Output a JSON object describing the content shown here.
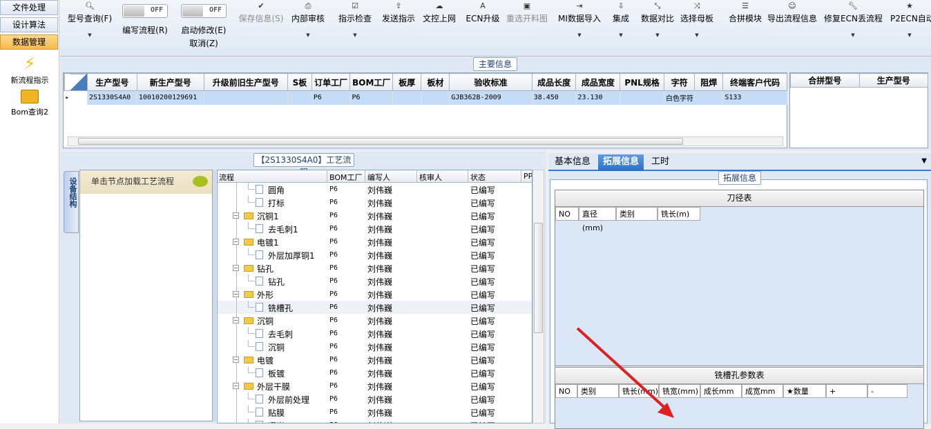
{
  "leftnav": {
    "items": [
      {
        "label": "文件处理"
      },
      {
        "label": "设计算法"
      },
      {
        "label": "数据管理"
      }
    ],
    "icons": [
      {
        "label": "新流程指示",
        "color": "#f1c40f"
      },
      {
        "label": "Bom查询2",
        "color": "#f0b323"
      }
    ]
  },
  "toolbar": {
    "buttons": [
      {
        "label": "型号查询(F)",
        "icon": "search-icon",
        "glyph": "🔍︎",
        "disabled": false,
        "dropdown": true
      },
      {
        "label": "保存信息(S)",
        "icon": "check-icon",
        "glyph": "✔",
        "disabled": true,
        "dropdown": false
      },
      {
        "label": "内部审核",
        "icon": "printer-icon",
        "glyph": "⎙",
        "disabled": false,
        "dropdown": true
      },
      {
        "label": "指示检查",
        "icon": "checkbox-icon",
        "glyph": "☑",
        "disabled": false,
        "dropdown": true
      },
      {
        "label": "发送指示",
        "icon": "upload-icon",
        "glyph": "⇪",
        "disabled": false,
        "dropdown": false
      },
      {
        "label": "文控上网",
        "icon": "cloud-upload-icon",
        "glyph": "☁",
        "disabled": false,
        "dropdown": false
      },
      {
        "label": "ECN升级",
        "icon": "font-icon",
        "glyph": "A",
        "disabled": false,
        "dropdown": false
      },
      {
        "label": "重选开料图",
        "icon": "picture-icon",
        "glyph": "▣",
        "disabled": true,
        "dropdown": false
      },
      {
        "label": "MI数据导入",
        "icon": "import-icon",
        "glyph": "⇥",
        "disabled": false,
        "dropdown": true
      },
      {
        "label": "集成",
        "icon": "download-icon",
        "glyph": "⇩",
        "disabled": false,
        "dropdown": true
      },
      {
        "label": "数据对比",
        "icon": "compress-icon",
        "glyph": "⤡",
        "disabled": false,
        "dropdown": true
      },
      {
        "label": "选择母板",
        "icon": "shuffle-icon",
        "glyph": "⤨",
        "disabled": false,
        "dropdown": true
      },
      {
        "label": "合拼模块",
        "icon": "list-icon",
        "glyph": "☰",
        "disabled": false,
        "dropdown": false
      },
      {
        "label": "导出流程信息",
        "icon": "smile-icon",
        "glyph": "☺",
        "disabled": false,
        "dropdown": false
      },
      {
        "label": "修复ECN丢流程",
        "icon": "wrench-icon",
        "glyph": "🔧︎",
        "disabled": false,
        "dropdown": true
      },
      {
        "label": "P2ECN自动",
        "icon": "star-icon",
        "glyph": "★",
        "disabled": false,
        "dropdown": true
      }
    ],
    "toggle_write": {
      "label": "编写流程(R)",
      "state": "OFF"
    },
    "toggle_modify": {
      "label1": "启动修改(E)",
      "label2": "取消(Z)",
      "state": "OFF"
    }
  },
  "main": {
    "title": "主要信息",
    "columns": [
      "生产型号",
      "新生产型号",
      "升级前旧生产型号",
      "S板",
      "订单工厂",
      "BOM工厂",
      "板厚",
      "板材",
      "验收标准",
      "成品长度",
      "成品宽度",
      "PNL规格",
      "字符",
      "阻焊",
      "终端客户代码"
    ],
    "rows": [
      [
        "2S1330S4A0",
        "10010200129691",
        "",
        "",
        "P6",
        "P6",
        "",
        "",
        "GJB362B-2009",
        "38.450",
        "23.130",
        "",
        "白色字符",
        "",
        "S133"
      ]
    ],
    "merge_columns": [
      "合拼型号",
      "生产型号"
    ]
  },
  "process": {
    "title": "【2S1330S4A0】工艺流程",
    "side_tab": "设备结构",
    "device_hint": "单击节点加载工艺流程",
    "columns": [
      "流程",
      "BOM工厂",
      "编写人",
      "核审人",
      "状态",
      "PP("
    ],
    "rows": [
      {
        "name": "圆角",
        "type": "file",
        "factory": "P6",
        "writer": "刘伟巍",
        "reviewer": "",
        "status": "已编写"
      },
      {
        "name": "打标",
        "type": "file",
        "factory": "P6",
        "writer": "刘伟巍",
        "reviewer": "",
        "status": "已编写"
      },
      {
        "name": "沉铜1",
        "type": "folder",
        "factory": "P6",
        "writer": "刘伟巍",
        "reviewer": "",
        "status": "已编写"
      },
      {
        "name": "去毛刺1",
        "type": "file",
        "factory": "P6",
        "writer": "刘伟巍",
        "reviewer": "",
        "status": "已编写"
      },
      {
        "name": "电镀1",
        "type": "folder",
        "factory": "P6",
        "writer": "刘伟巍",
        "reviewer": "",
        "status": "已编写"
      },
      {
        "name": "外层加厚铜1",
        "type": "file",
        "factory": "P6",
        "writer": "刘伟巍",
        "reviewer": "",
        "status": "已编写"
      },
      {
        "name": "钻孔",
        "type": "folder",
        "factory": "P6",
        "writer": "刘伟巍",
        "reviewer": "",
        "status": "已编写"
      },
      {
        "name": "钻孔",
        "type": "file",
        "factory": "P6",
        "writer": "刘伟巍",
        "reviewer": "",
        "status": "已编写"
      },
      {
        "name": "外形",
        "type": "folder",
        "factory": "P6",
        "writer": "刘伟巍",
        "reviewer": "",
        "status": "已编写"
      },
      {
        "name": "铣槽孔",
        "type": "file",
        "factory": "P6",
        "writer": "刘伟巍",
        "reviewer": "",
        "status": "已编写",
        "selected": true
      },
      {
        "name": "沉铜",
        "type": "folder",
        "factory": "P6",
        "writer": "刘伟巍",
        "reviewer": "",
        "status": "已编写"
      },
      {
        "name": "去毛刺",
        "type": "file",
        "factory": "P6",
        "writer": "刘伟巍",
        "reviewer": "",
        "status": "已编写"
      },
      {
        "name": "沉铜",
        "type": "file",
        "factory": "P6",
        "writer": "刘伟巍",
        "reviewer": "",
        "status": "已编写"
      },
      {
        "name": "电镀",
        "type": "folder",
        "factory": "P6",
        "writer": "刘伟巍",
        "reviewer": "",
        "status": "已编写"
      },
      {
        "name": "板镀",
        "type": "file",
        "factory": "P6",
        "writer": "刘伟巍",
        "reviewer": "",
        "status": "已编写"
      },
      {
        "name": "外层干膜",
        "type": "folder",
        "factory": "P6",
        "writer": "刘伟巍",
        "reviewer": "",
        "status": "已编写"
      },
      {
        "name": "外层前处理",
        "type": "file",
        "factory": "P6",
        "writer": "刘伟巍",
        "reviewer": "",
        "status": "已编写"
      },
      {
        "name": "贴膜",
        "type": "file",
        "factory": "P6",
        "writer": "刘伟巍",
        "reviewer": "",
        "status": "已编写"
      },
      {
        "name": "曝光",
        "type": "file",
        "factory": "P6",
        "writer": "刘伟巍",
        "reviewer": "",
        "status": "已编写"
      }
    ]
  },
  "right": {
    "tabs": [
      "基本信息",
      "拓展信息",
      "工时"
    ],
    "active_tab": 1,
    "ext_title": "拓展信息",
    "tool_table": {
      "title": "刀径表",
      "columns": [
        "NO",
        "直径(mm)",
        "类别",
        "铣长(m)"
      ]
    },
    "slot_table": {
      "title": "铣槽孔参数表",
      "columns": [
        "NO",
        "类别",
        "铣长(mm)",
        "铣宽(mm)",
        "成长mm",
        "成宽mm",
        "★数量",
        "+",
        "-"
      ]
    }
  },
  "colors": {
    "accent": "#3a78c8",
    "active_nav": "#f6b84c",
    "arrow": "#e02020",
    "selected_row": "#c5dcf7"
  }
}
